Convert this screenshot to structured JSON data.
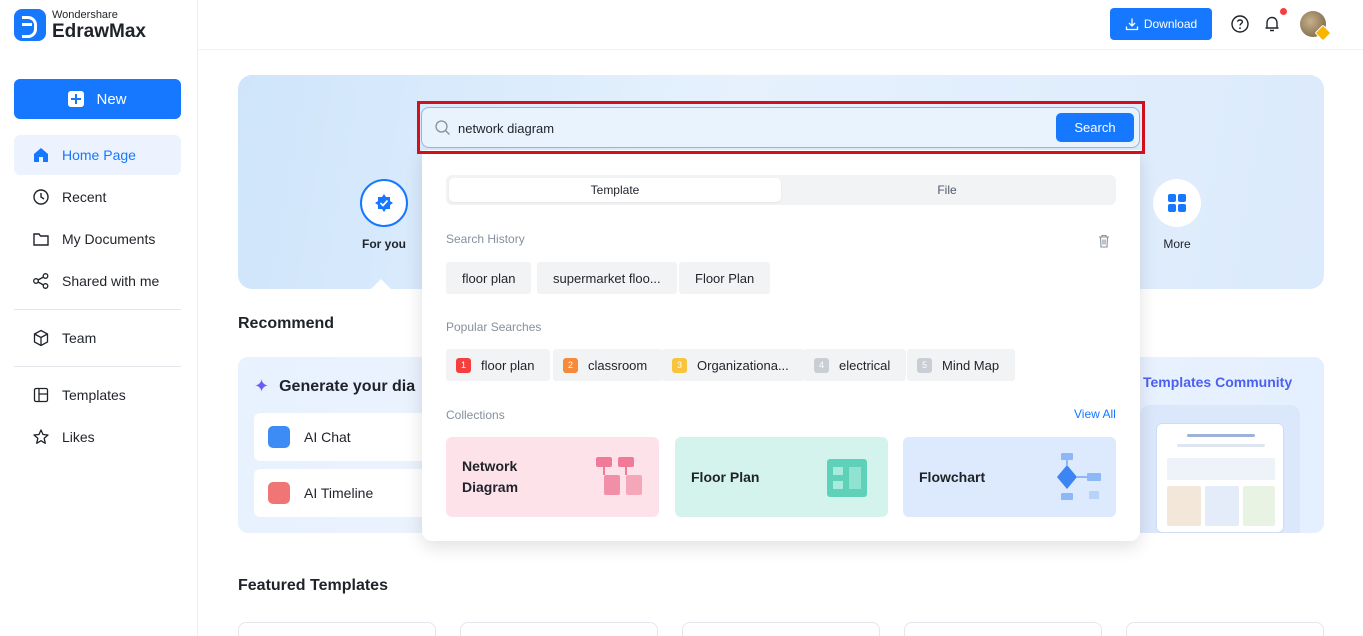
{
  "app": {
    "brand_sub": "Wondershare",
    "brand_main": "EdrawMax"
  },
  "sidebar": {
    "new_label": "New",
    "items": [
      {
        "label": "Home Page",
        "icon": "home-icon",
        "active": true
      },
      {
        "label": "Recent",
        "icon": "clock-icon"
      },
      {
        "label": "My Documents",
        "icon": "folder-icon"
      },
      {
        "label": "Shared with me",
        "icon": "share-icon"
      },
      {
        "label": "Team",
        "icon": "team-icon"
      },
      {
        "label": "Templates",
        "icon": "templates-icon"
      },
      {
        "label": "Likes",
        "icon": "star-icon"
      }
    ]
  },
  "header": {
    "download_label": "Download",
    "icons": [
      "help-icon",
      "bell-icon",
      "avatar"
    ]
  },
  "hero": {
    "categories": [
      {
        "label": "For you",
        "icon": "for-you-icon",
        "selected": true
      },
      {
        "label": "More",
        "icon": "grid-icon"
      }
    ]
  },
  "recommend": {
    "title": "Recommend",
    "generate_title": "Generate your dia",
    "ai_items": [
      {
        "label": "AI Chat",
        "icon": "ai-chat-icon"
      },
      {
        "label": "AI Timeline",
        "icon": "ai-timeline-icon"
      }
    ],
    "community_title": "Templates Community"
  },
  "featured": {
    "title": "Featured Templates"
  },
  "search": {
    "value": "network diagram",
    "button_label": "Search",
    "tabs": [
      "Template",
      "File"
    ],
    "active_tab": "Template",
    "history_label": "Search History",
    "history": [
      "floor plan",
      "supermarket floo...",
      "Floor Plan"
    ],
    "popular_label": "Popular Searches",
    "popular": [
      {
        "rank": "1",
        "label": "floor plan",
        "color": "#f53f3f"
      },
      {
        "rank": "2",
        "label": "classroom",
        "color": "#f7893b"
      },
      {
        "rank": "3",
        "label": "Organizationa...",
        "color": "#f7c43b"
      },
      {
        "rank": "4",
        "label": "electrical",
        "color": "#c9cdd4"
      },
      {
        "rank": "5",
        "label": "Mind Map",
        "color": "#c9cdd4"
      }
    ],
    "collections_label": "Collections",
    "view_all": "View All",
    "collections": [
      {
        "line1": "Network",
        "line2": "Diagram",
        "bg": "#fde2ea"
      },
      {
        "line1": "Floor Plan",
        "line2": "",
        "bg": "#d4f3ec"
      },
      {
        "line1": "Flowchart",
        "line2": "",
        "bg": "#dde9fd"
      }
    ]
  },
  "colors": {
    "accent": "#1677ff",
    "highlight_frame": "#d0101b"
  }
}
